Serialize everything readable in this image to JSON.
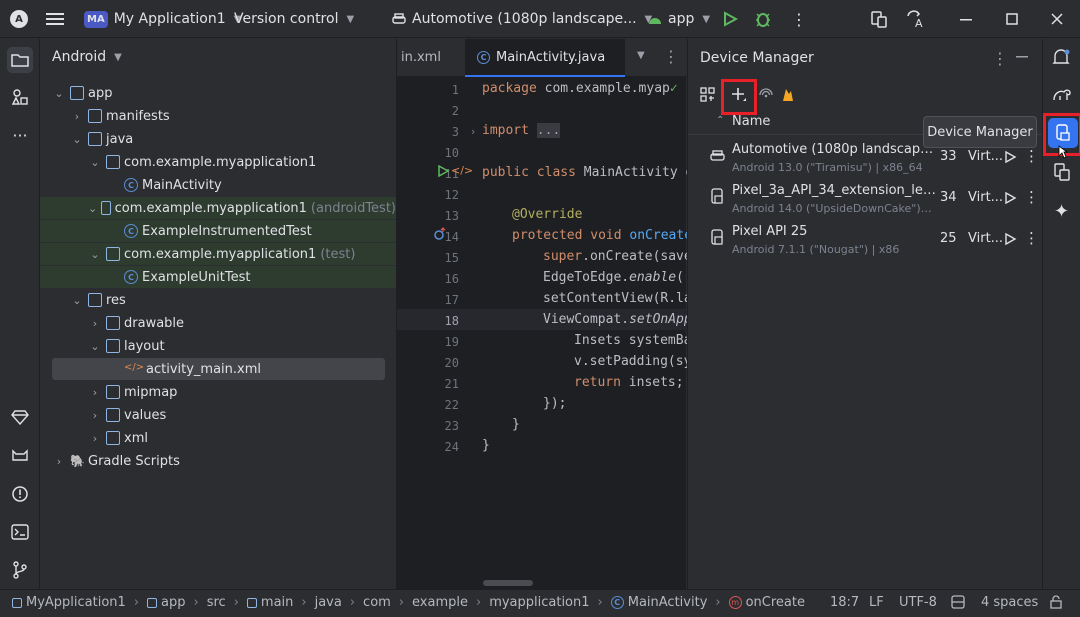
{
  "titlebar": {
    "project_badge": "MA",
    "project_name": "My Application1",
    "vcs": "Version control",
    "device": "Automotive (1080p landscape...",
    "run_config": "app"
  },
  "project_panel": {
    "title": "Android",
    "tree": [
      "app",
      "manifests",
      "java",
      "com.example.myapplication1",
      "MainActivity",
      "com.example.myapplication1",
      "(androidTest)",
      "ExampleInstrumentedTest",
      "com.example.myapplication1",
      "(test)",
      "ExampleUnitTest",
      "res",
      "drawable",
      "layout",
      "activity_main.xml",
      "mipmap",
      "values",
      "xml",
      "Gradle Scripts"
    ]
  },
  "editor": {
    "tabs": [
      "in.xml",
      "MainActivity.java"
    ],
    "line_numbers": [
      "1",
      "2",
      "3",
      "10",
      "11",
      "12",
      "13",
      "14",
      "15",
      "16",
      "17",
      "18",
      "19",
      "20",
      "21",
      "22",
      "23",
      "24"
    ],
    "code": {
      "l1a": "package",
      "l1b": " com.example.myap",
      "l3a": "import",
      "l3b": "...",
      "l11a": "public class",
      "l11b": " MainActivity e",
      "l13": "@Override",
      "l14a": "protected void",
      "l14b": " onCreate",
      "l15a": "super",
      "l15b": ".onCreate(save",
      "l16a": "EdgeToEdge.",
      "l16b": "enable",
      "l16c": "(",
      "l17": "setContentView(R.la",
      "l18a": "ViewCompat.",
      "l18b": "setOnApp",
      "l19": "Insets systemBa",
      "l20": "v.setPadding(sy",
      "l21a": "return",
      "l21b": " insets;",
      "l22": "});",
      "l23": "}",
      "l24": "}"
    }
  },
  "device_manager": {
    "title": "Device Manager",
    "column_name": "Name",
    "devices": [
      {
        "name": "Automotive (1080p landscape) AP...",
        "sub": "Android 13.0 (\"Tiramisu\") | x86_64",
        "api": "33",
        "type": "Virt..."
      },
      {
        "name": "Pixel_3a_API_34_extension_level_...",
        "sub": "Android 14.0 (\"UpsideDownCake\") | x...",
        "api": "34",
        "type": "Virt..."
      },
      {
        "name": "Pixel API 25",
        "sub": "Android 7.1.1 (\"Nougat\") | x86",
        "api": "25",
        "type": "Virt..."
      }
    ],
    "tooltip": "Device Manager"
  },
  "status_bar": {
    "crumbs": [
      "MyApplication1",
      "app",
      "src",
      "main",
      "java",
      "com",
      "example",
      "myapplication1",
      "MainActivity",
      "onCreate"
    ],
    "position": "18:7",
    "line_sep": "LF",
    "encoding": "UTF-8",
    "indent": "4 spaces"
  },
  "colors": {
    "accent": "#3574f0",
    "highlight_red": "#e8202a",
    "test_bg": "#2e3b2f"
  }
}
